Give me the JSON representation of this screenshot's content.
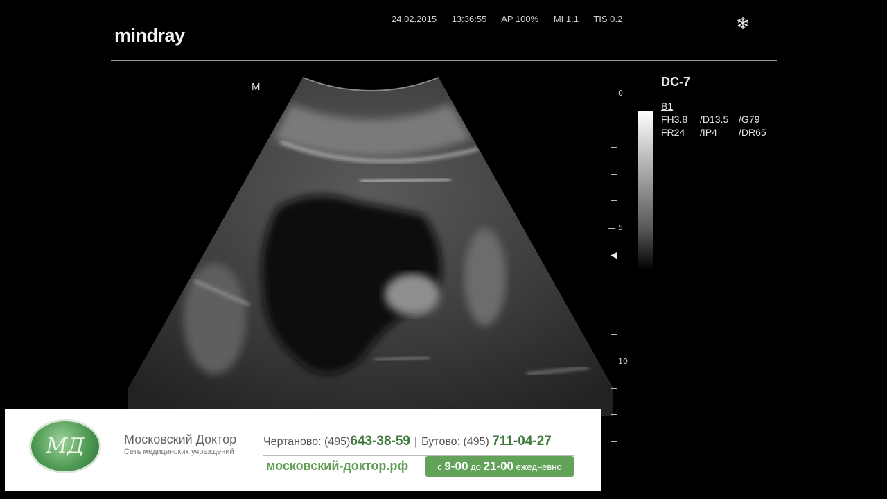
{
  "header": {
    "brand": "mindray",
    "date": "24.02.2015",
    "time": "13:36:55",
    "ap": "AP 100%",
    "mi": "MI 1.1",
    "tis": "TIS 0.2",
    "freeze_icon": "snowflake-icon"
  },
  "image": {
    "orientation_marker": "M",
    "depth_labels": [
      "0",
      "5",
      "10"
    ]
  },
  "probe": "DC-7",
  "params": {
    "mode": "B1",
    "row1": [
      "FH3.8",
      "/D13.5",
      "/G79"
    ],
    "row2": [
      "FR24",
      "/IP4",
      "/DR65"
    ]
  },
  "banner": {
    "logo_monogram": "МД",
    "org_name": "Московский Доктор",
    "org_subtitle": "Сеть медицинских учреждений",
    "branch1_label": "Чертаново:",
    "branch1_code": "(495)",
    "branch1_number": "643-38-59",
    "separator": "|",
    "branch2_label": "Бутово:",
    "branch2_code": "(495)",
    "branch2_number": "711-04-27",
    "website": "московский-доктор.рф",
    "hours_prefix": "с",
    "hours_open": "9-00",
    "hours_mid": "до",
    "hours_close": "21-00",
    "hours_suffix": "ежедневно"
  },
  "colors": {
    "brand_green": "#62a259",
    "phone_green": "#3f7a3c"
  }
}
